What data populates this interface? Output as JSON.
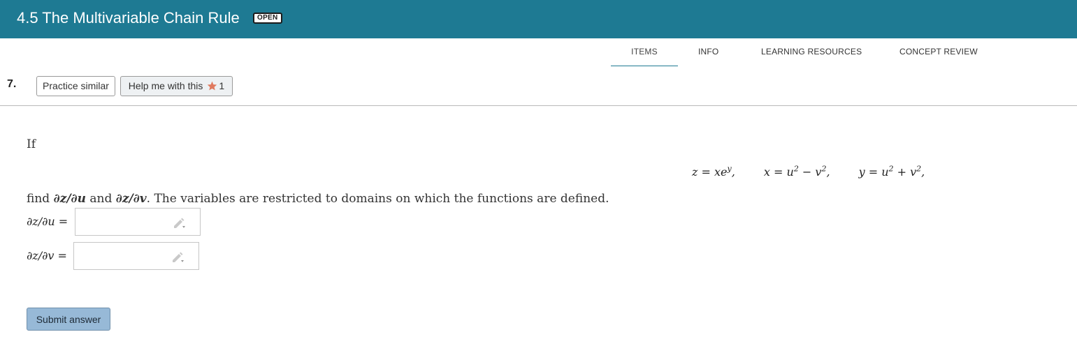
{
  "header": {
    "title": "4.5 The Multivariable Chain Rule",
    "status": "OPEN"
  },
  "tabs": [
    {
      "label": "ITEMS"
    },
    {
      "label": "INFO"
    },
    {
      "label": "LEARNING RESOURCES"
    },
    {
      "label": "CONCEPT REVIEW"
    }
  ],
  "question": {
    "number": "7.",
    "practice_label": "Practice similar",
    "help_label": "Help me with this",
    "help_count": "1",
    "intro": "If",
    "eq1": "z = xe",
    "eq1_sup": "y",
    "eq1_tail": ",",
    "eq2": "x = u",
    "eq2_mid": " − v",
    "eq2_tail": ",",
    "eq3": "y = u",
    "eq3_mid": " + v",
    "eq3_tail": ",",
    "exp2": "2",
    "find_pre": "find ",
    "find_du": "∂z/∂u",
    "find_and": " and ",
    "find_dv": "∂z/∂v",
    "find_post": ". The variables are restricted to domains on which the functions are defined.",
    "answer1_label": "∂z/∂u =",
    "answer2_label": "∂z/∂v =",
    "answer1_value": "",
    "answer2_value": ""
  },
  "submit_label": "Submit answer",
  "colors": {
    "header_bg": "#1e7a93",
    "submit_bg": "#97b9d7",
    "star": "#e07a5f"
  }
}
